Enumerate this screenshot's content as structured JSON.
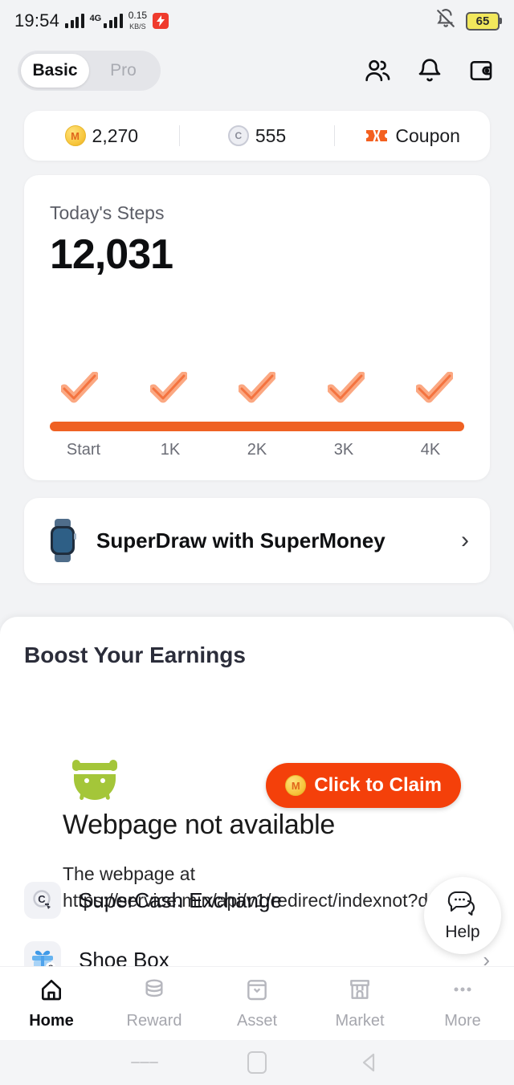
{
  "status_bar": {
    "time": "19:54",
    "network_type": "4G",
    "data_speed_value": "0.15",
    "data_speed_unit": "KB/S",
    "app_badge_glyph": "↯",
    "battery_level": "65",
    "mute_icon": "bell-muted-icon"
  },
  "header": {
    "segmented": {
      "options": [
        "Basic",
        "Pro"
      ],
      "selected": "Basic"
    },
    "icons": [
      "contacts-icon",
      "notification-bell-icon",
      "wallet-icon"
    ]
  },
  "balance_bar": {
    "items": [
      {
        "icon": "m-coin-icon",
        "symbol": "M",
        "value": "2,270"
      },
      {
        "icon": "c-coin-icon",
        "symbol": "C",
        "value": "555"
      },
      {
        "icon": "coupon-ticket-icon",
        "value": "Coupon"
      }
    ]
  },
  "steps_card": {
    "label": "Today's Steps",
    "value": "12,031",
    "checkmark_count": 5,
    "progress_percent": 100,
    "ticks": [
      "Start",
      "1K",
      "2K",
      "3K",
      "4K"
    ]
  },
  "promo": {
    "icon": "smartwatch-icon",
    "title": "SuperDraw with SuperMoney",
    "chevron": "›"
  },
  "boost_sheet": {
    "title": "Boost Your Earnings",
    "claim_button": {
      "label": "Click to Claim",
      "coin": "M",
      "color": "#f4400a"
    },
    "error": {
      "icon": "broken-android-icon",
      "title": "Webpage not available",
      "body_line1": "The webpage at",
      "body_line2": "https://service.min/api/v1/redirect/indexnot?de"
    },
    "list": [
      {
        "icon": "supercash-exchange-icon",
        "label": "SuperCash Exchange"
      },
      {
        "icon": "shoe-box-gift-icon",
        "label": "Shoe Box",
        "chevron": "›"
      }
    ]
  },
  "help_fab": {
    "label": "Help",
    "icon": "chat-bubble-icon"
  },
  "bottom_nav": {
    "items": [
      {
        "label": "Home",
        "icon": "home-icon",
        "active": true
      },
      {
        "label": "Reward",
        "icon": "coins-icon",
        "active": false
      },
      {
        "label": "Asset",
        "icon": "wallet-bag-icon",
        "active": false
      },
      {
        "label": "Market",
        "icon": "store-icon",
        "active": false
      },
      {
        "label": "More",
        "icon": "ellipsis-icon",
        "active": false
      }
    ]
  },
  "system_nav": {
    "buttons": [
      "recents-button",
      "home-button",
      "back-button"
    ]
  }
}
